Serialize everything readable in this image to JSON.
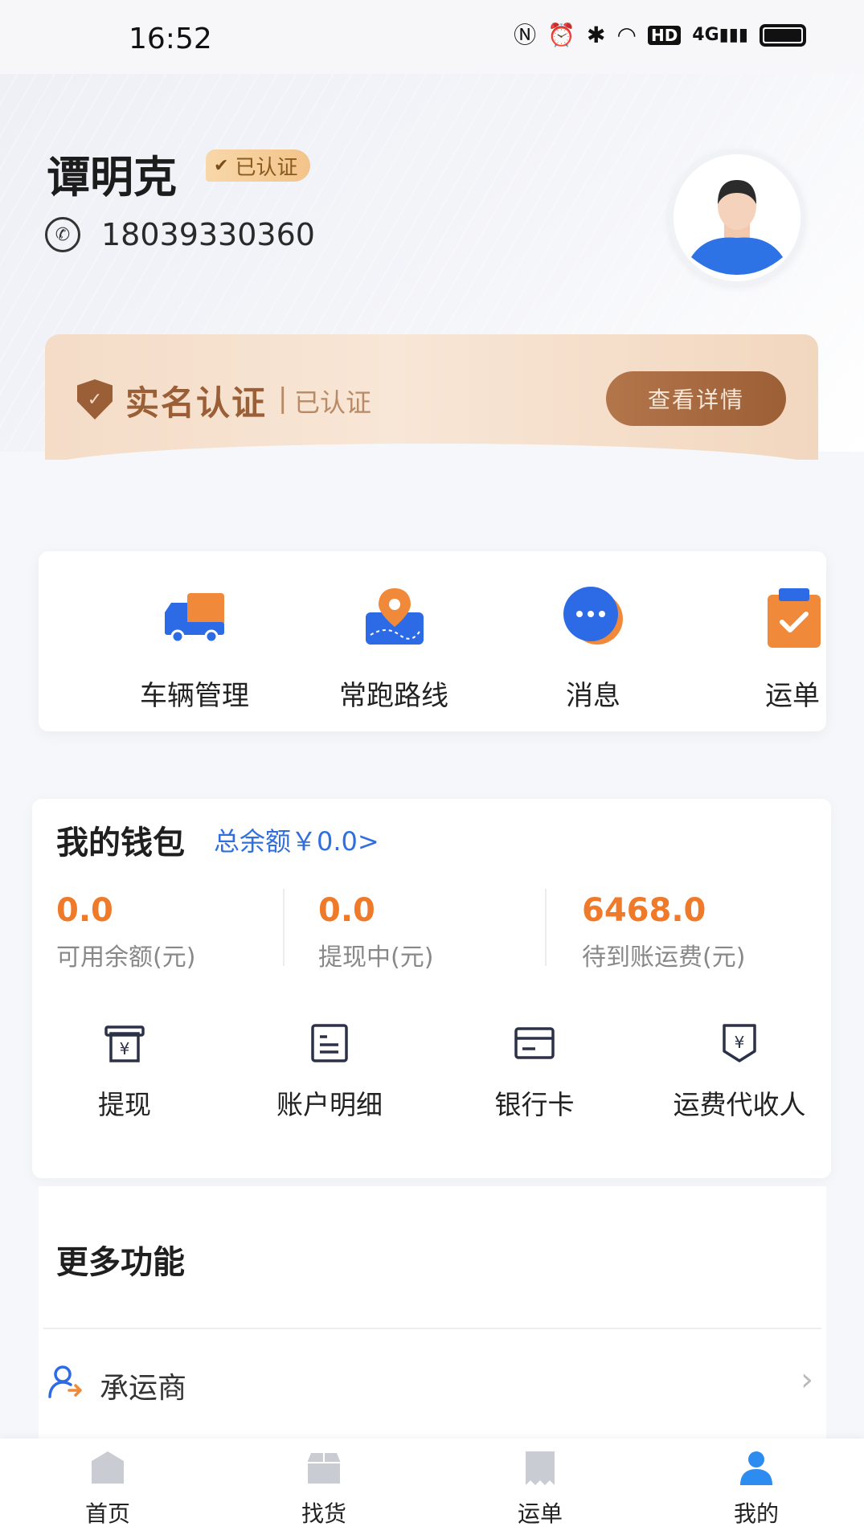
{
  "status_bar": {
    "time": "16:52",
    "icons": [
      "nfc-icon",
      "alarm-icon",
      "bluetooth-icon",
      "wifi-icon",
      "hd-icon",
      "signal-4g-icon",
      "battery-icon"
    ],
    "hd": "HD",
    "net": "4G"
  },
  "profile": {
    "name": "谭明克",
    "badge": "已认证",
    "phone": "18039330360"
  },
  "realname": {
    "title": "实名认证",
    "separator": "|",
    "status": "已认证",
    "button": "查看详情"
  },
  "quick_actions": [
    {
      "label": "车辆管理",
      "icon": "truck-icon"
    },
    {
      "label": "常跑路线",
      "icon": "route-pin-icon"
    },
    {
      "label": "消息",
      "icon": "message-icon"
    },
    {
      "label": "运单",
      "icon": "waybill-icon"
    }
  ],
  "wallet": {
    "title": "我的钱包",
    "total": "总余额￥0.0>",
    "stats": [
      {
        "value": "0.0",
        "label": "可用余额(元)"
      },
      {
        "value": "0.0",
        "label": "提现中(元)"
      },
      {
        "value": "6468.0",
        "label": "待到账运费(元)"
      }
    ],
    "actions": [
      {
        "label": "提现",
        "icon": "withdraw-icon"
      },
      {
        "label": "账户明细",
        "icon": "account-detail-icon"
      },
      {
        "label": "银行卡",
        "icon": "bank-card-icon"
      },
      {
        "label": "运费代收人",
        "icon": "freight-agent-icon"
      }
    ]
  },
  "more": {
    "title": "更多功能",
    "items": [
      {
        "label": "承运商",
        "icon": "carrier-icon"
      }
    ]
  },
  "tabbar": [
    {
      "label": "首页",
      "icon": "home-icon",
      "active": false
    },
    {
      "label": "找货",
      "icon": "box-icon",
      "active": false
    },
    {
      "label": "运单",
      "icon": "waybill-tab-icon",
      "active": false
    },
    {
      "label": "我的",
      "icon": "person-icon",
      "active": true
    }
  ],
  "colors": {
    "accent_blue": "#2f6fe0",
    "orange": "#ef7a2a",
    "gold_brown": "#9c5f36",
    "tab_inactive": "#c9ccd3"
  }
}
